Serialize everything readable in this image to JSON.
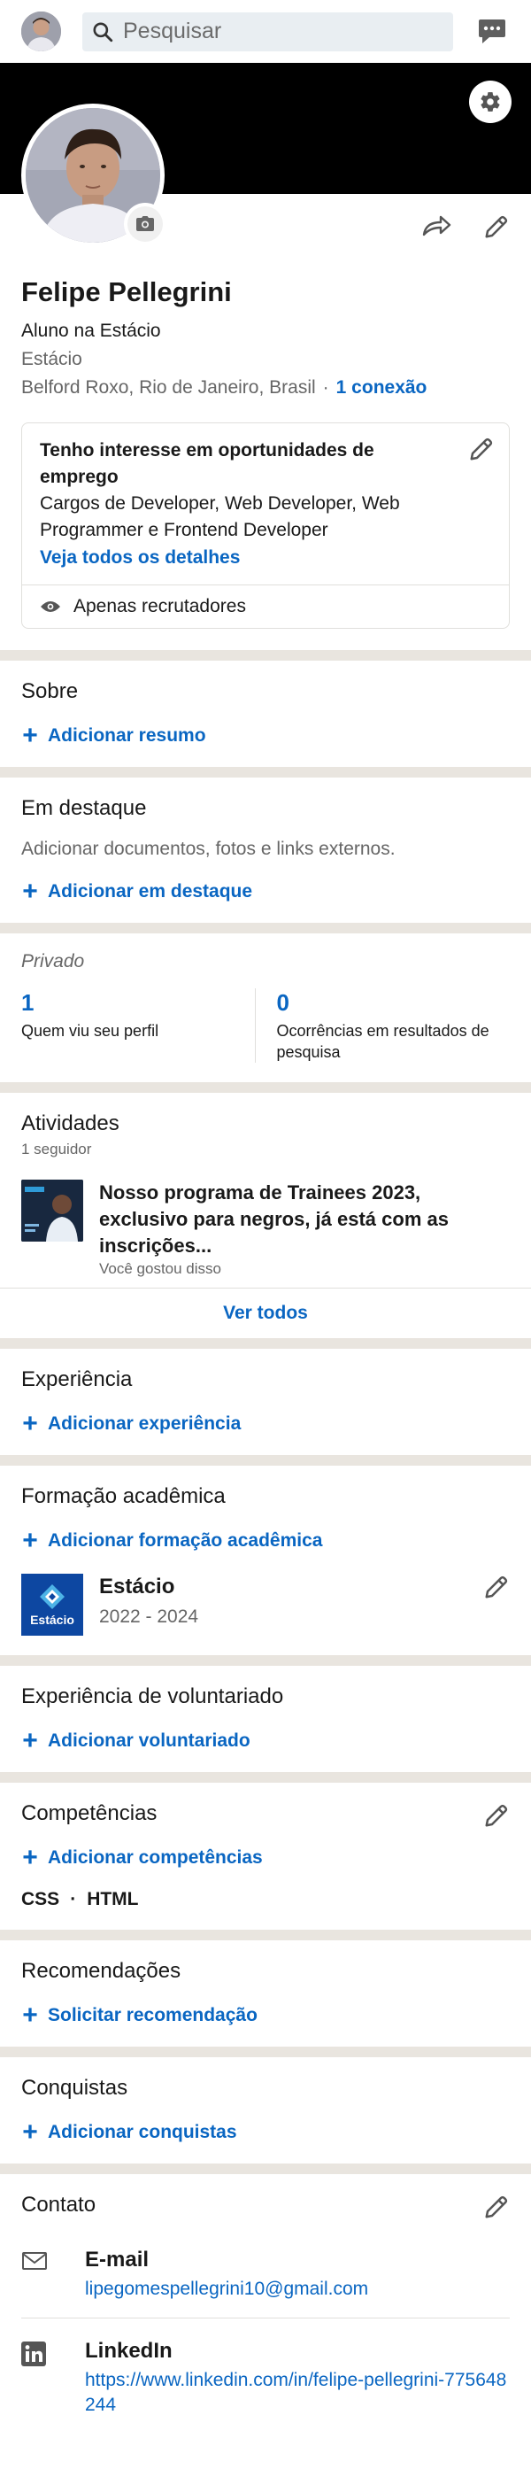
{
  "search": {
    "placeholder": "Pesquisar"
  },
  "profile": {
    "name": "Felipe Pellegrini",
    "headline": "Aluno na Estácio",
    "company": "Estácio",
    "location": "Belford Roxo, Rio de Janeiro, Brasil",
    "separator": "·",
    "connections": "1 conexão"
  },
  "open_to_work": {
    "title": "Tenho interesse em oportunidades de emprego",
    "roles": "Cargos de Developer, Web Developer, Web Programmer e Frontend Developer",
    "details_link": "Veja todos os detalhes",
    "visibility": "Apenas recrutadores"
  },
  "about": {
    "title": "Sobre",
    "add": "Adicionar resumo"
  },
  "featured": {
    "title": "Em destaque",
    "description": "Adicionar documentos, fotos e links externos.",
    "add": "Adicionar em destaque"
  },
  "analytics": {
    "label": "Privado",
    "items": [
      {
        "value": "1",
        "label": "Quem viu seu perfil"
      },
      {
        "value": "0",
        "label": "Ocorrências em resultados de pesquisa"
      }
    ]
  },
  "activity": {
    "title": "Atividades",
    "followers": "1 seguidor",
    "post_title": "Nosso programa de Trainees 2023, exclusivo para negros, já está com as inscrições...",
    "post_sub": "Você gostou disso",
    "see_all": "Ver todos"
  },
  "experience": {
    "title": "Experiência",
    "add": "Adicionar experiência"
  },
  "education": {
    "title": "Formação acadêmica",
    "add": "Adicionar formação acadêmica",
    "items": [
      {
        "school": "Estácio",
        "years": "2022 - 2024",
        "logo_text": "Estácio"
      }
    ]
  },
  "volunteer": {
    "title": "Experiência de voluntariado",
    "add": "Adicionar voluntariado"
  },
  "skills": {
    "title": "Competências",
    "add": "Adicionar competências",
    "list": [
      "CSS",
      "HTML"
    ],
    "separator": "·"
  },
  "recommendations": {
    "title": "Recomendações",
    "add": "Solicitar recomendação"
  },
  "accomplishments": {
    "title": "Conquistas",
    "add": "Adicionar conquistas"
  },
  "contact": {
    "title": "Contato",
    "items": [
      {
        "label": "E-mail",
        "value": "lipegomespellegrini10@gmail.com",
        "icon": "envelope-icon"
      },
      {
        "label": "LinkedIn",
        "value": "https://www.linkedin.com/in/felipe-pellegrini-775648244",
        "icon": "linkedin-icon"
      }
    ]
  },
  "colors": {
    "link_blue": "#0a66c2",
    "separator": "#e9e5df",
    "cover": "#000000",
    "search_bg": "#e9eef2"
  }
}
